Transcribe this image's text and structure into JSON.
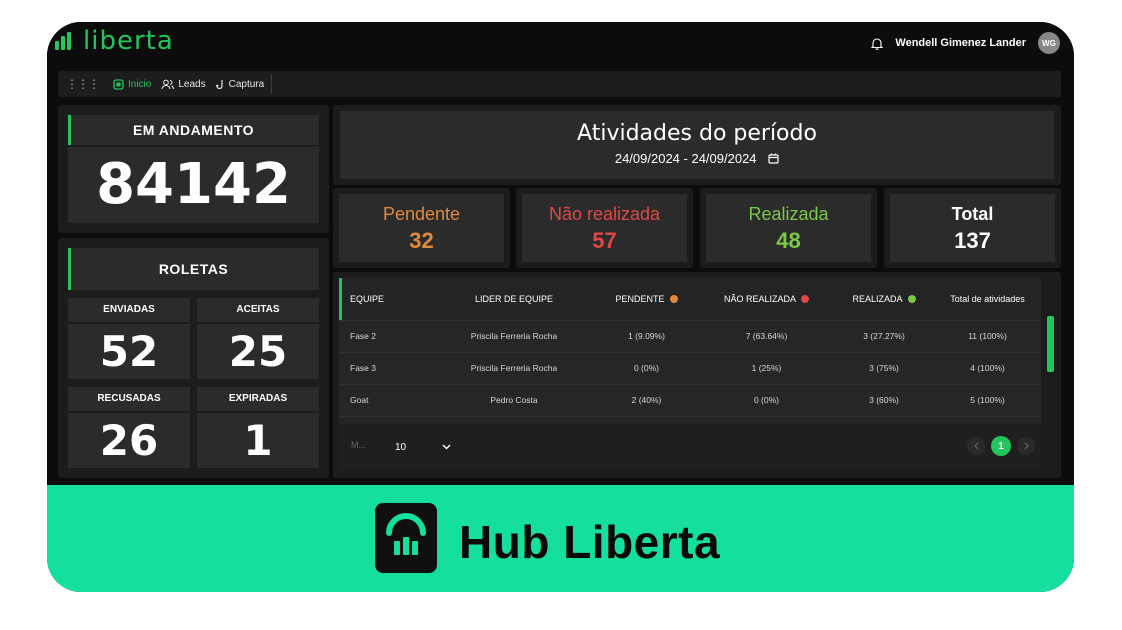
{
  "header": {
    "logo_text": "liberta",
    "user_name": "Wendell Gimenez Lander",
    "avatar_initials": "WG"
  },
  "nav": {
    "items": [
      {
        "label": "Inicio",
        "icon": "home-icon",
        "active": true
      },
      {
        "label": "Leads",
        "icon": "users-icon",
        "active": false
      },
      {
        "label": "Captura",
        "icon": "hook-icon",
        "active": false
      }
    ]
  },
  "em_andamento": {
    "label": "EM ANDAMENTO",
    "value": "84142"
  },
  "roletas": {
    "title": "ROLETAS",
    "enviadas": {
      "label": "ENVIADAS",
      "value": "52"
    },
    "aceitas": {
      "label": "ACEITAS",
      "value": "25"
    },
    "recusadas": {
      "label": "RECUSADAS",
      "value": "26"
    },
    "expiradas": {
      "label": "EXPIRADAS",
      "value": "1"
    }
  },
  "atividades": {
    "title": "Atividades do período",
    "date_range": "24/09/2024 - 24/09/2024",
    "stats": [
      {
        "label": "Pendente",
        "value": "32",
        "color": "#e08a3c"
      },
      {
        "label": "Não realizada",
        "value": "57",
        "color": "#e04848"
      },
      {
        "label": "Realizada",
        "value": "48",
        "color": "#7cc84a"
      },
      {
        "label": "Total",
        "value": "137",
        "color": "#ffffff"
      }
    ]
  },
  "table": {
    "headers": [
      "EQUIPE",
      "LIDER DE EQUIPE",
      "PENDENTE",
      "NÃO REALIZADA",
      "REALIZADA",
      "Total de atividades"
    ],
    "header_dot_colors": [
      "",
      "",
      "#e08a3c",
      "#e04848",
      "#7cc84a",
      ""
    ],
    "rows": [
      [
        "Fase 2",
        "Priscila Ferreria Rocha",
        "1 (9.09%)",
        "7 (63.64%)",
        "3 (27.27%)",
        "11 (100%)"
      ],
      [
        "Fase 3",
        "Priscila Ferreria Rocha",
        "0 (0%)",
        "1 (25%)",
        "3 (75%)",
        "4 (100%)"
      ],
      [
        "Goat",
        "Pedro Costa",
        "2 (40%)",
        "0 (0%)",
        "3 (60%)",
        "5 (100%)"
      ]
    ],
    "pagination": {
      "rows_label": "M...",
      "rows_per_page": "10",
      "current_page": "1",
      "prev_icon": "chevron-left-icon",
      "next_icon": "chevron-right-icon"
    }
  },
  "banner": {
    "brand_name": "Hub Liberta",
    "color": "#14df9e"
  }
}
